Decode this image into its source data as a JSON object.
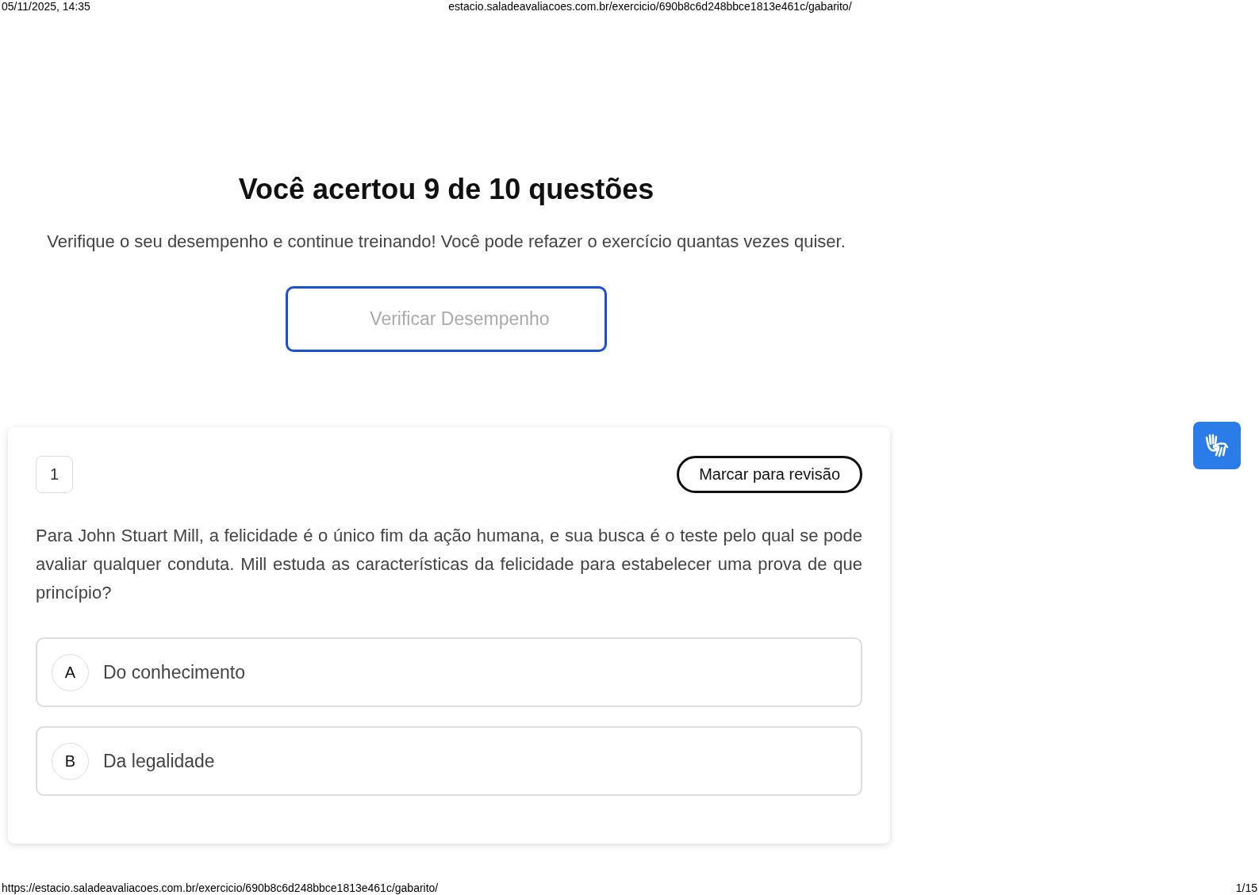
{
  "print_header": {
    "date": "05/11/2025, 14:35",
    "url": "estacio.saladeavaliacoes.com.br/exercicio/690b8c6d248bbce1813e461c/gabarito/"
  },
  "result": {
    "title": "Você acertou 9 de 10 questões",
    "subtitle": "Verifique o seu desempenho e continue treinando! Você pode refazer o exercício quantas vezes quiser.",
    "button": "Verificar Desempenho"
  },
  "question": {
    "number": "1",
    "review_button": "Marcar para revisão",
    "text": "Para John Stuart Mill, a felicidade é o único fim da ação humana, e sua busca é o teste pelo qual se pode avaliar qualquer conduta. Mill estuda as características da felicidade para estabelecer uma prova de que princípio?",
    "options": [
      {
        "letter": "A",
        "text": "Do conhecimento"
      },
      {
        "letter": "B",
        "text": "Da legalidade"
      }
    ]
  },
  "print_footer": {
    "url": "https://estacio.saladeavaliacoes.com.br/exercicio/690b8c6d248bbce1813e461c/gabarito/",
    "page": "1/15"
  }
}
